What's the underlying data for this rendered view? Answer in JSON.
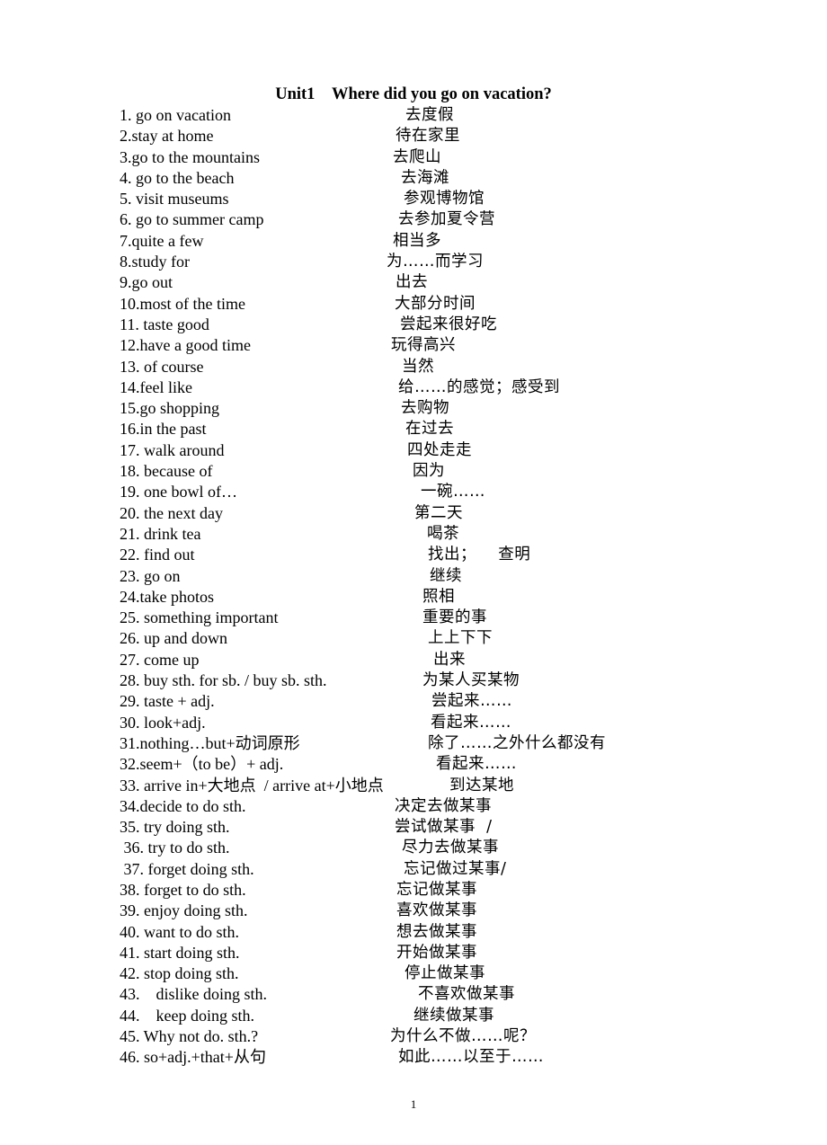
{
  "document": {
    "title_unit": "Unit1",
    "title_text": "Where did you go on vacation?",
    "page_number": "1"
  },
  "rows": [
    {
      "en": "1. go on vacation",
      "zh": "去度假"
    },
    {
      "en": "2.stay at home",
      "zh": "待在家里"
    },
    {
      "en": "3.go to the mountains",
      "zh": "去爬山"
    },
    {
      "en": "4. go to the beach",
      "zh": "去海滩"
    },
    {
      "en": "5. visit museums",
      "zh": "参观博物馆"
    },
    {
      "en": "6. go to summer camp",
      "zh": "去参加夏令营"
    },
    {
      "en": "7.quite a few",
      "zh": "相当多"
    },
    {
      "en": "8.study for",
      "zh": "为……而学习"
    },
    {
      "en": "9.go out",
      "zh": "出去"
    },
    {
      "en": "10.most of the time",
      "zh": "大部分时间"
    },
    {
      "en": "11. taste good",
      "zh": "尝起来很好吃"
    },
    {
      "en": "12.have a good time",
      "zh": "玩得高兴"
    },
    {
      "en": "13. of course",
      "zh": "当然"
    },
    {
      "en": "14.feel like",
      "zh": "给……的感觉；感受到"
    },
    {
      "en": "15.go shopping",
      "zh": "去购物"
    },
    {
      "en": "16.in the past",
      "zh": "在过去"
    },
    {
      "en": "17. walk around",
      "zh": "四处走走"
    },
    {
      "en": "18. because of",
      "zh": "因为"
    },
    {
      "en": "19. one bowl of…",
      "zh": "一碗……"
    },
    {
      "en": "20. the next day",
      "zh": "第二天"
    },
    {
      "en": "21. drink tea",
      "zh": "喝茶"
    },
    {
      "en": "22. find out",
      "zh": "找出；    查明"
    },
    {
      "en": "23. go on",
      "zh": "继续"
    },
    {
      "en": "24.take photos",
      "zh": "照相"
    },
    {
      "en": "25. something important",
      "zh": "重要的事"
    },
    {
      "en": "26. up and down",
      "zh": "上上下下"
    },
    {
      "en": "27. come up",
      "zh": "出来"
    },
    {
      "en": "28. buy sth. for sb. / buy sb. sth.",
      "zh": "为某人买某物"
    },
    {
      "en": "29. taste + adj.",
      "zh": "尝起来……"
    },
    {
      "en": "30. look+adj.",
      "zh": "看起来……"
    },
    {
      "en": "31.nothing…but+动词原形",
      "zh": "除了……之外什么都没有"
    },
    {
      "en": "32.seem+（to be）+ adj.",
      "zh": "看起来……"
    },
    {
      "en": "33. arrive in+大地点  / arrive at+小地点",
      "zh": "到达某地"
    },
    {
      "en": "34.decide to do sth.",
      "zh": "决定去做某事"
    },
    {
      "en": "35. try doing sth.",
      "zh": "尝试做某事  /"
    },
    {
      "en": " 36. try to do sth.",
      "zh": "尽力去做某事"
    },
    {
      "en": " 37. forget doing sth.",
      "zh": "忘记做过某事/"
    },
    {
      "en": "38. forget to do sth.",
      "zh": "忘记做某事"
    },
    {
      "en": "39. enjoy doing sth.",
      "zh": "喜欢做某事"
    },
    {
      "en": "40. want to do sth.",
      "zh": "想去做某事"
    },
    {
      "en": "41. start doing sth.",
      "zh": "开始做某事"
    },
    {
      "en": "42. stop doing sth.",
      "zh": "停止做某事"
    },
    {
      "en": "43.    dislike doing sth.",
      "zh": "不喜欢做某事"
    },
    {
      "en": "44.    keep doing sth.",
      "zh": "继续做某事"
    },
    {
      "en": "45. Why not do. sth.?",
      "zh": "为什么不做……呢？"
    },
    {
      "en": "46. so+adj.+that+从句",
      "zh": "如此……以至于……"
    }
  ]
}
